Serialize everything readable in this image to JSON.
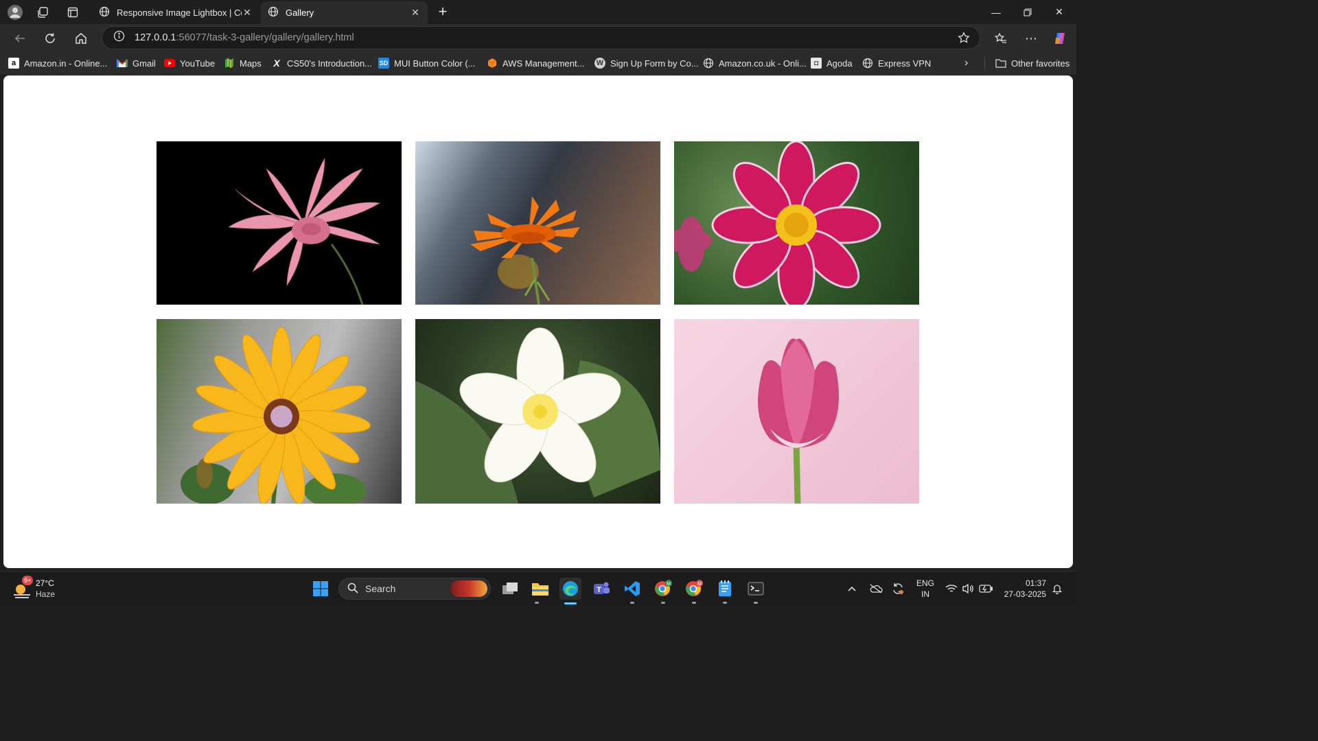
{
  "browser": {
    "tabs": [
      {
        "label": "Responsive Image Lightbox | Cod",
        "icon": "globe-icon",
        "active": false
      },
      {
        "label": "Gallery",
        "icon": "globe-icon",
        "active": true
      }
    ],
    "address": {
      "host": "127.0.0.1",
      "path": ":56077/task-3-gallery/gallery/gallery.html"
    },
    "bookmarks": [
      {
        "label": "Amazon.in - Online...",
        "icon": "amazon-icon"
      },
      {
        "label": "Gmail",
        "icon": "gmail-icon"
      },
      {
        "label": "YouTube",
        "icon": "youtube-icon"
      },
      {
        "label": "Maps",
        "icon": "maps-icon"
      },
      {
        "label": "CS50's Introduction...",
        "icon": "edx-icon"
      },
      {
        "label": "MUI Button Color (...",
        "icon": "sd-icon"
      },
      {
        "label": "AWS Management...",
        "icon": "aws-icon"
      },
      {
        "label": "Sign Up Form by Co...",
        "icon": "wordpress-icon"
      },
      {
        "label": "Amazon.co.uk - Onli...",
        "icon": "globe-icon"
      },
      {
        "label": "Agoda",
        "icon": "agoda-icon"
      },
      {
        "label": "Express VPN",
        "icon": "globe-icon"
      }
    ],
    "other_favorites": "Other favorites"
  },
  "gallery": {
    "images": [
      {
        "name": "pink-gerbera-flower",
        "bg": "#000000",
        "petal": "#e48ca5",
        "center": "#c4587a"
      },
      {
        "name": "orange-calendula-flower",
        "bg": "#6a6e78",
        "petal": "#f07a12",
        "center": "#e15a05"
      },
      {
        "name": "pink-dahlia-flower",
        "bg": "#3f6b35",
        "petal": "#d0185e",
        "center": "#f2c21a"
      },
      {
        "name": "yellow-daisy-flower",
        "bg": "#8f8f8f",
        "petal": "#f8b81c",
        "center": "#7a3a18"
      },
      {
        "name": "white-plumeria-flower",
        "bg": "#2d3d24",
        "petal": "#fafaf2",
        "center": "#f3d533"
      },
      {
        "name": "pink-tulip-flower",
        "bg": "#f1c8d8",
        "petal": "#d0457a",
        "center": "#c12f66"
      }
    ]
  },
  "taskbar": {
    "weather": {
      "temp": "27°C",
      "condition": "Haze",
      "badge": "9+"
    },
    "search_label": "Search",
    "language": {
      "line1": "ENG",
      "line2": "IN"
    },
    "clock": {
      "time": "01:37",
      "date": "27-03-2025"
    }
  },
  "colors": {
    "accent": "#0078d4",
    "chrome_bg": "#1f1f1f",
    "toolbar_bg": "#2b2b2b"
  }
}
